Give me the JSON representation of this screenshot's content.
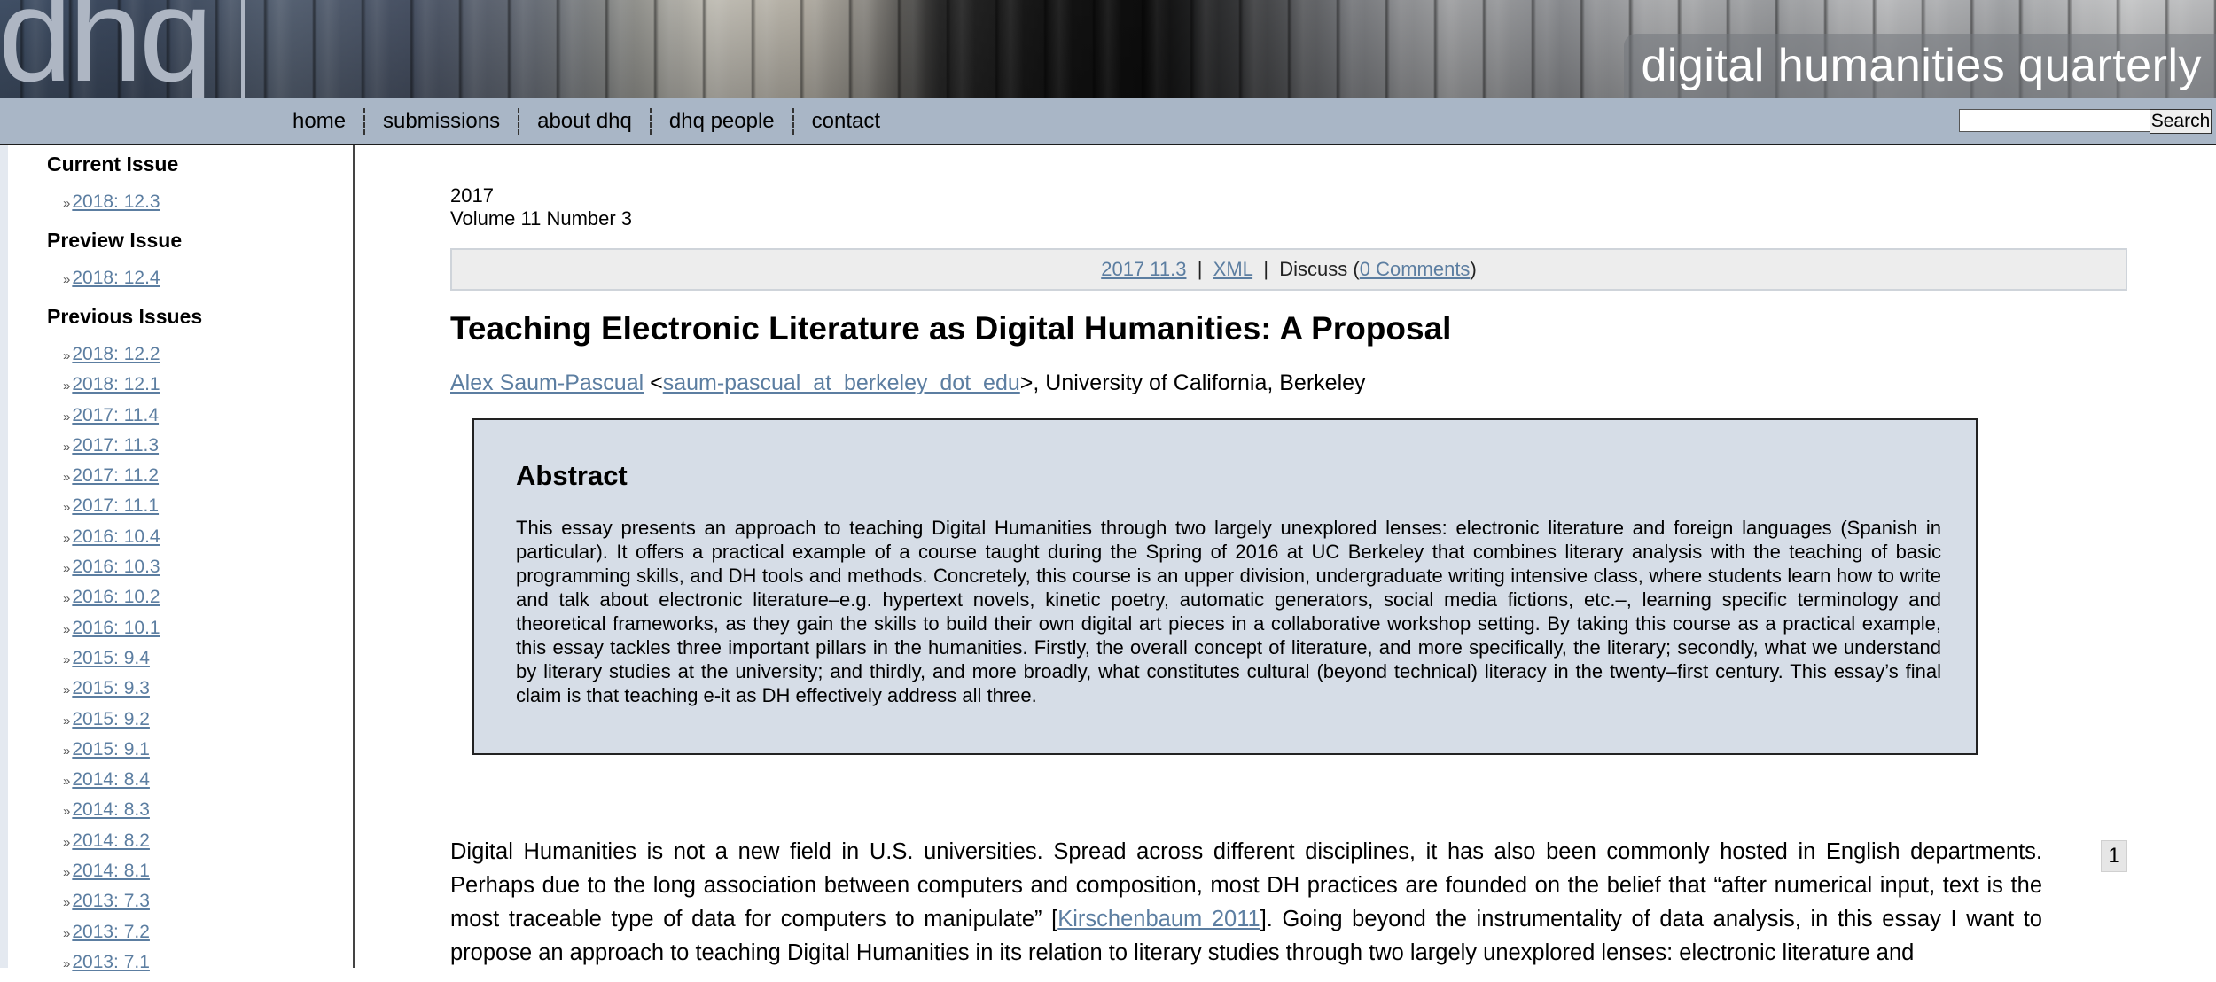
{
  "site": {
    "logo": "dhq",
    "title": "digital humanities quarterly"
  },
  "nav": {
    "items": [
      "home",
      "submissions",
      "about dhq",
      "dhq people",
      "contact"
    ],
    "search_value": "",
    "search_button": "Search"
  },
  "sidebar": {
    "current_heading": "Current Issue",
    "current_issue": "2018: 12.3",
    "preview_heading": "Preview Issue",
    "preview_issue": "2018: 12.4",
    "previous_heading": "Previous Issues",
    "previous_issues": [
      "2018: 12.2",
      "2018: 12.1",
      "2017: 11.4",
      "2017: 11.3",
      "2017: 11.2",
      "2017: 11.1",
      "2016: 10.4",
      "2016: 10.3",
      "2016: 10.2",
      "2016: 10.1",
      "2015: 9.4",
      "2015: 9.3",
      "2015: 9.2",
      "2015: 9.1",
      "2014: 8.4",
      "2014: 8.3",
      "2014: 8.2",
      "2014: 8.1",
      "2013: 7.3",
      "2013: 7.2",
      "2013: 7.1"
    ],
    "bullet": "»"
  },
  "issue": {
    "year": "2017",
    "volume": "Volume 11 Number 3"
  },
  "toolbar": {
    "issue_link": "2017 11.3",
    "xml_link": "XML",
    "discuss_prefix": "Discuss (",
    "comments_link": "0 Comments",
    "discuss_suffix": ")",
    "sep": "|"
  },
  "article": {
    "title": "Teaching Electronic Literature as Digital Humanities: A Proposal",
    "author": "Alex Saum-Pascual",
    "email": "saum-pascual_at_berkeley_dot_edu",
    "affiliation": ", University of California, Berkeley",
    "abstract_heading": "Abstract",
    "abstract": "This essay presents an approach to teaching Digital Humanities through two largely unexplored lenses: electronic literature and foreign languages (Spanish in particular). It offers a practical example of a course taught during the Spring of 2016 at UC Berkeley that combines literary analysis with the teaching of basic programming skills, and DH tools and methods. Concretely, this course is an upper division, undergraduate writing intensive class, where students learn how to write and talk about electronic literature–e.g. hypertext novels, kinetic poetry, automatic generators, social media fictions, etc.–, learning specific terminology and theoretical frameworks, as they gain the skills to build their own digital art pieces in a collaborative workshop setting. By taking this course as a practical example, this essay tackles three important pillars in the humanities. Firstly, the overall concept of literature, and more specifically, the literary; secondly, what we understand by literary studies at the university; and thirdly, and more broadly, what constitutes cultural (beyond technical) literacy in the twenty–first century. This essay’s final claim is that teaching e-it as DH effectively address all three.",
    "para1_before": "Digital Humanities is not a new field in U.S. universities. Spread across different disciplines, it has also been commonly hosted in English departments. Perhaps due to the long association between computers and composition, most DH practices are founded on the belief that “after numerical input, text is the most traceable type of data for computers to manipulate”  [",
    "para1_citation": "Kirschenbaum 2011",
    "para1_after": "]. Going beyond the instrumentality of data analysis, in this essay I want to propose an approach to teaching Digital Humanities in its relation to literary studies through two largely unexplored lenses: electronic literature and",
    "para1_number": "1"
  }
}
